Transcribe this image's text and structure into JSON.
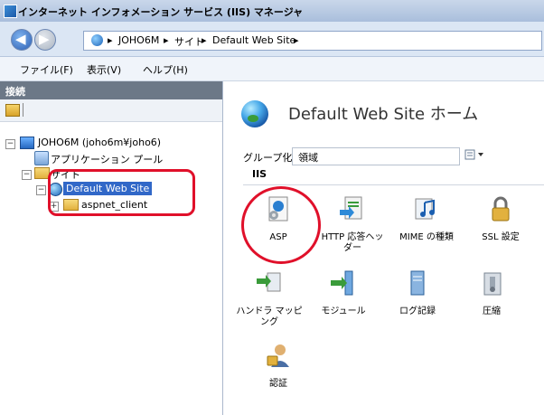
{
  "window": {
    "title": "インターネット インフォメーション サービス (IIS) マネージャ"
  },
  "address": {
    "crumbs": [
      "JOHO6M",
      "サイト",
      "Default Web Site"
    ],
    "separator": "▸"
  },
  "menu": {
    "items": [
      "ファイル(F)",
      "表示(V)",
      "ヘルプ(H)"
    ]
  },
  "connections": {
    "header": "接続",
    "tree": {
      "server": "JOHO6M (joho6m¥joho6)",
      "app_pools": "アプリケーション プール",
      "sites": "サイト",
      "default_site": "Default Web Site",
      "child": "aspnet_client"
    }
  },
  "home": {
    "title": "Default Web Site ホーム",
    "group_label": "グループ化:",
    "group_value": "領域",
    "section": "IIS",
    "features": [
      {
        "label": "ASP",
        "icon": "asp-icon"
      },
      {
        "label": "HTTP 応答ヘッダー",
        "icon": "http-headers-icon"
      },
      {
        "label": "MIME の種類",
        "icon": "mime-types-icon"
      },
      {
        "label": "SSL 設定",
        "icon": "ssl-icon"
      },
      {
        "label": "ハンドラ マッピング",
        "icon": "handler-mappings-icon"
      },
      {
        "label": "モジュール",
        "icon": "modules-icon"
      },
      {
        "label": "ログ記録",
        "icon": "logging-icon"
      },
      {
        "label": "圧縮",
        "icon": "compression-icon"
      },
      {
        "label": "認証",
        "icon": "authentication-icon"
      }
    ]
  },
  "colors": {
    "highlight": "#e0102a",
    "selection": "#3168c8"
  }
}
